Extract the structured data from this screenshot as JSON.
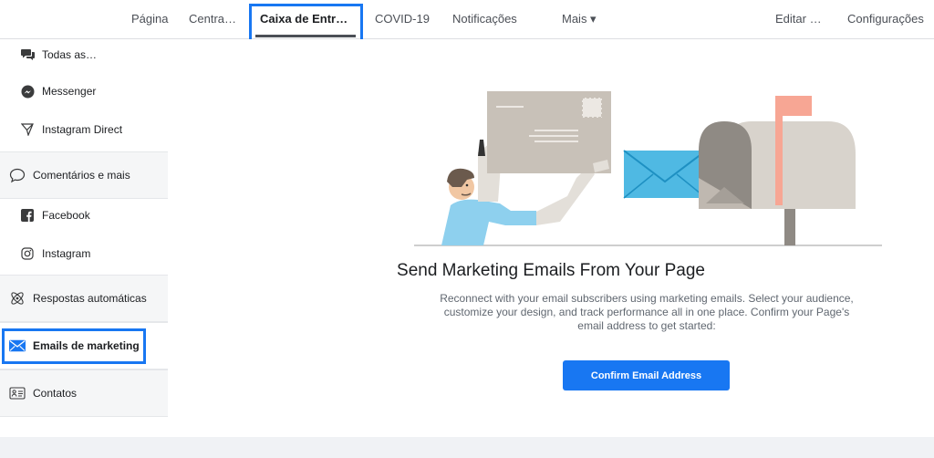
{
  "nav": {
    "items": [
      {
        "label": "Página"
      },
      {
        "label": "Centra…"
      },
      {
        "label": "Caixa de Entr…"
      },
      {
        "label": "COVID-19"
      },
      {
        "label": "Notificações"
      },
      {
        "label": "Mais ▾"
      },
      {
        "label": "Editar …"
      },
      {
        "label": "Configurações"
      }
    ],
    "active_index": 2
  },
  "sidebar": {
    "items": [
      {
        "label": "Todas as…",
        "icon": "chat-bubbles-icon"
      },
      {
        "label": "Messenger",
        "icon": "messenger-icon"
      },
      {
        "label": "Instagram Direct",
        "icon": "paper-plane-icon"
      },
      {
        "label": "Comentários e mais",
        "icon": "comment-icon"
      },
      {
        "label": "Facebook",
        "icon": "facebook-icon"
      },
      {
        "label": "Instagram",
        "icon": "instagram-icon"
      },
      {
        "label": "Respostas automáticas",
        "icon": "atom-icon"
      },
      {
        "label": "Emails de marketing",
        "icon": "envelope-icon"
      },
      {
        "label": "Contatos",
        "icon": "contact-card-icon"
      }
    ],
    "selected_index": 7
  },
  "main": {
    "title": "Send Marketing Emails From Your Page",
    "description": "Reconnect with your email subscribers using marketing emails. Select your audience, customize your design, and track performance all in one place. Confirm your Page's email address to get started:",
    "cta_label": "Confirm Email Address"
  },
  "colors": {
    "accent": "#1877f2",
    "highlight": "#1877f2",
    "mailbox_flag": "#f7a694",
    "envelope": "#4fb9e3"
  }
}
